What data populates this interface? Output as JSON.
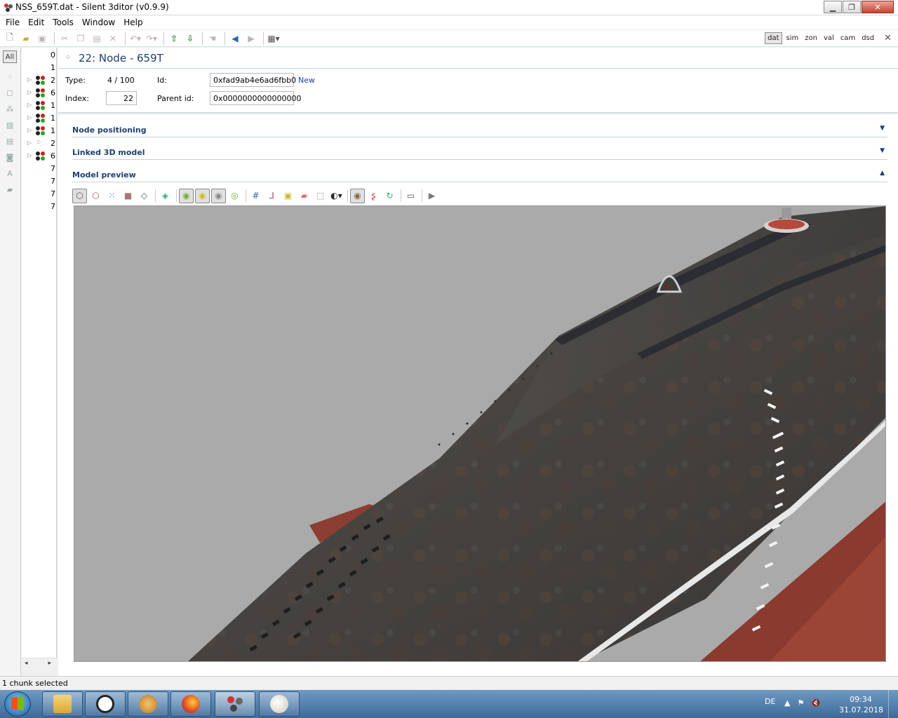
{
  "window": {
    "title": "NSS_659T.dat - Silent 3ditor (v0.9.9)",
    "controls": {
      "minimize": "▁",
      "maximize": "❐",
      "close": "✕"
    }
  },
  "menu": [
    "File",
    "Edit",
    "Tools",
    "Window",
    "Help"
  ],
  "toolbar": {
    "modes": [
      "dat",
      "sim",
      "zon",
      "val",
      "cam",
      "dsd"
    ],
    "active_mode": "dat",
    "close_symbol": "✕"
  },
  "strip": {
    "all_label": "All"
  },
  "tree": {
    "rows": [
      {
        "index": "0",
        "icon": "none",
        "expander": ""
      },
      {
        "index": "1",
        "icon": "none",
        "expander": ""
      },
      {
        "index": "2",
        "icon": "dots",
        "expander": "▷"
      },
      {
        "index": "6",
        "icon": "dots",
        "expander": "▷"
      },
      {
        "index": "1",
        "icon": "dots",
        "expander": "▷"
      },
      {
        "index": "1",
        "icon": "dots",
        "expander": "▷"
      },
      {
        "index": "1",
        "icon": "dots",
        "expander": "▷"
      },
      {
        "index": "2",
        "icon": "node",
        "expander": "▷"
      },
      {
        "index": "6",
        "icon": "dots",
        "expander": "▷"
      },
      {
        "index": "7",
        "icon": "none",
        "expander": ""
      },
      {
        "index": "7",
        "icon": "none",
        "expander": ""
      },
      {
        "index": "7",
        "icon": "none",
        "expander": ""
      },
      {
        "index": "7",
        "icon": "none",
        "expander": ""
      }
    ],
    "scroll_left": "◂",
    "scroll_right": "▸"
  },
  "node": {
    "title": "22: Node - 659T",
    "type_label": "Type:",
    "type_value": "4 / 100",
    "id_label": "Id:",
    "id_value": "0xfad9ab4e6ad6fbb0",
    "new_link": "New",
    "index_label": "Index:",
    "index_value": "22",
    "parent_label": "Parent id:",
    "parent_value": "0x0000000000000000"
  },
  "sections": [
    {
      "title": "Node positioning",
      "chevron": "▼"
    },
    {
      "title": "Linked 3D model",
      "chevron": "▼"
    },
    {
      "title": "Model preview",
      "chevron": "▲"
    }
  ],
  "status": {
    "text": "1 chunk selected"
  },
  "taskbar": {
    "language": "DE",
    "time": "09:34",
    "date": "31.07.2018"
  },
  "colors": {
    "accent": "#1f3f70",
    "viewport_bg": "#aaaaaa",
    "hull": "#4a4744",
    "hull_red": "#8a3a2e"
  }
}
